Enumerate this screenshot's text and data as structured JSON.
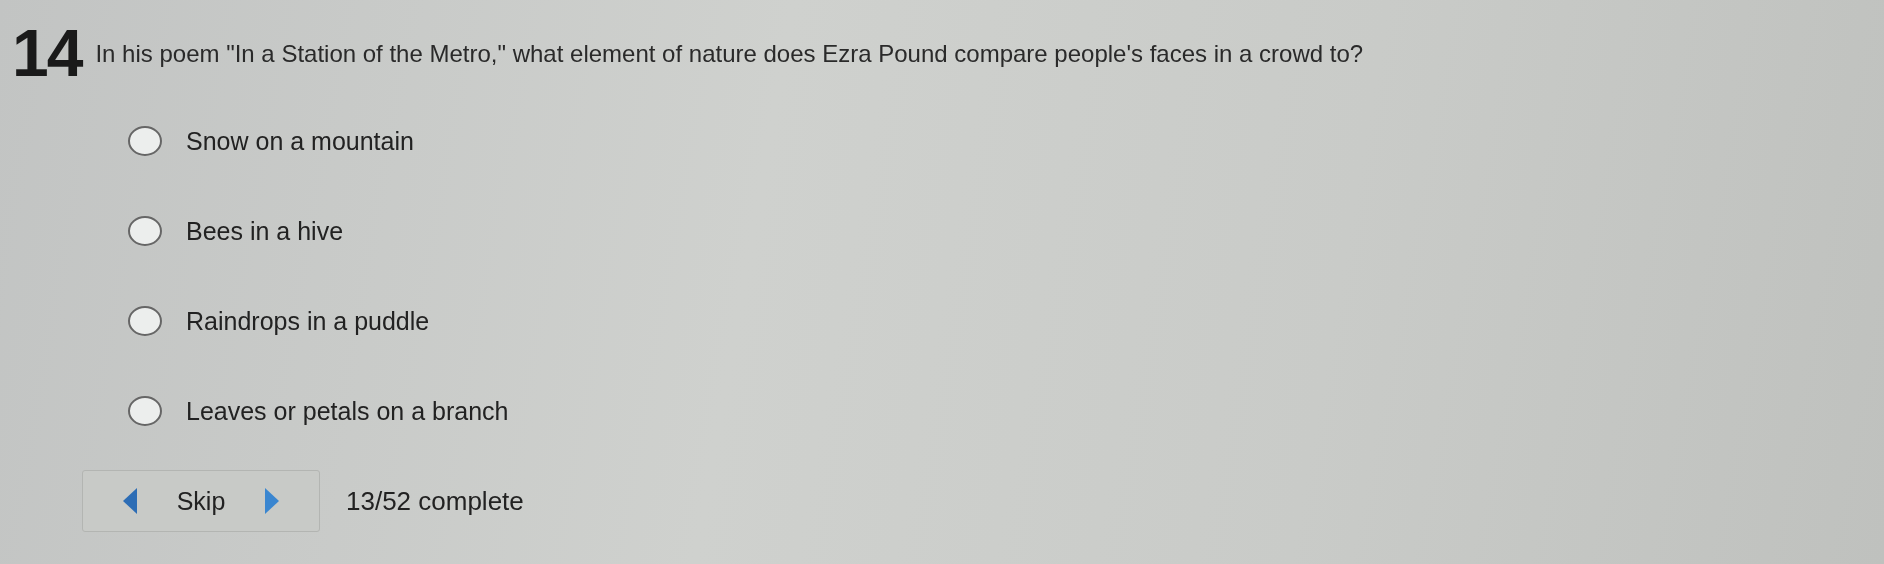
{
  "question": {
    "number": "14",
    "text": "In his poem \"In a Station of the Metro,\" what element of nature does Ezra Pound compare people's faces in a crowd to?"
  },
  "options": [
    {
      "label": "Snow on a mountain",
      "selected": false
    },
    {
      "label": "Bees in a hive",
      "selected": false
    },
    {
      "label": "Raindrops in a puddle",
      "selected": false
    },
    {
      "label": "Leaves or petals on a branch",
      "selected": false
    }
  ],
  "footer": {
    "skip": "Skip",
    "progress": "13/52 complete"
  }
}
